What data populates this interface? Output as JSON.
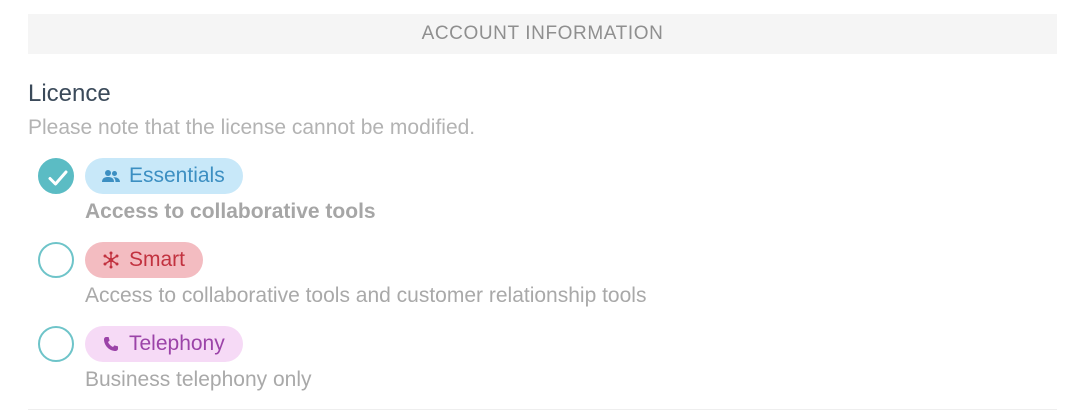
{
  "section": {
    "header": "ACCOUNT INFORMATION"
  },
  "licence": {
    "title": "Licence",
    "note": "Please note that the license cannot be modified.",
    "options": [
      {
        "label": "Essentials",
        "icon": "users-icon",
        "description": "Access to collaborative tools",
        "selected": true,
        "color": "#3c8fc2",
        "background": "#c8e8f9"
      },
      {
        "label": "Smart",
        "icon": "network-icon",
        "description": "Access to collaborative tools and customer relationship tools",
        "selected": false,
        "color": "#c2323f",
        "background": "#f3bcc1"
      },
      {
        "label": "Telephony",
        "icon": "phone-icon",
        "description": "Business telephony only",
        "selected": false,
        "color": "#9b43a8",
        "background": "#f6daf6"
      }
    ]
  },
  "accent_color": "#5bbcc4"
}
